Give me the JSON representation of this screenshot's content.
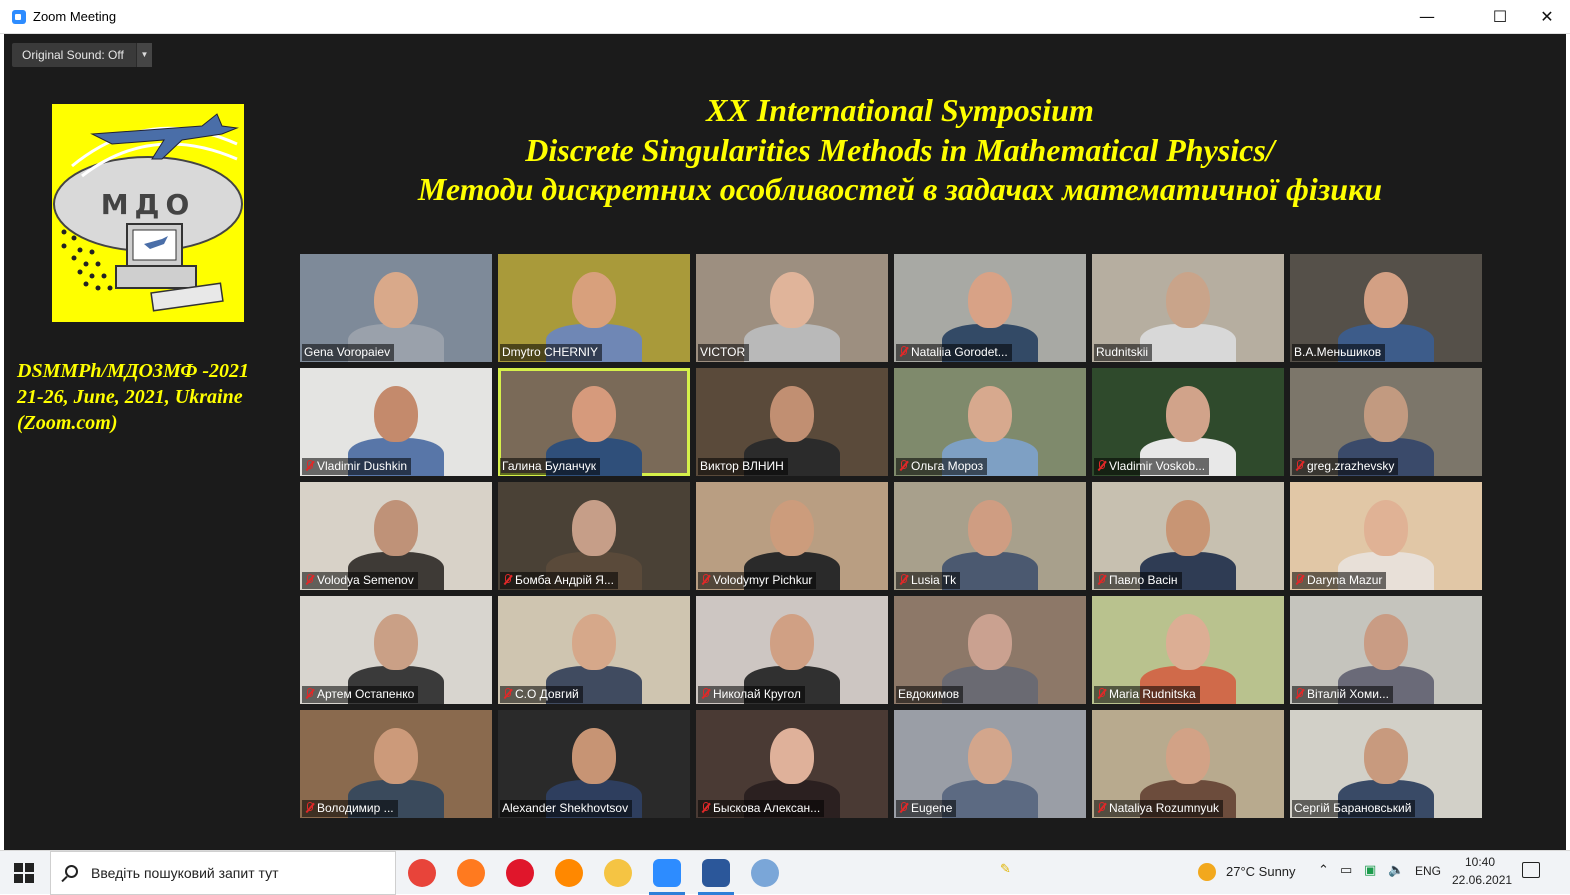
{
  "window": {
    "title": "Zoom Meeting",
    "minimize": "—",
    "maximize": "☐",
    "close": "✕"
  },
  "toolbar": {
    "original_sound": "Original Sound: Off",
    "dropdown_arrow": "▼"
  },
  "logo": {
    "text": "МДО"
  },
  "left_info": {
    "line1": "DSMMPh/МДОЗМФ -2021",
    "line2": "21-26, June, 2021, Ukraine",
    "line3": "(Zoom.com)"
  },
  "heading": {
    "line1": "XX International Symposium",
    "line2": "Discrete Singularities Methods in Mathematical Physics/",
    "line3": "Методи дискретних особливостей в задачах математичної фізики"
  },
  "participants": [
    {
      "name": "Gena Voropaiev",
      "muted": false,
      "bg": "#7e8a99",
      "skin": "#d9a98a",
      "shirt": "#9aa1ab"
    },
    {
      "name": "Dmytro CHERNIY",
      "muted": false,
      "bg": "#a99a3a",
      "skin": "#d8a07c",
      "shirt": "#6f87b5"
    },
    {
      "name": "VICTOR",
      "muted": false,
      "bg": "#9d8f80",
      "skin": "#e0b49a",
      "shirt": "#b9b9b9"
    },
    {
      "name": "Nataliia Gorodet...",
      "muted": true,
      "bg": "#a8a9a4",
      "skin": "#d8a286",
      "shirt": "#334a66"
    },
    {
      "name": "Rudnitskii",
      "muted": false,
      "bg": "#b6aea0",
      "skin": "#c9a48a",
      "shirt": "#d8d8d8"
    },
    {
      "name": "В.А.Меньшиков",
      "muted": false,
      "bg": "#555049",
      "skin": "#d3a084",
      "shirt": "#3d5c8a"
    },
    {
      "name": "Vladimir Dushkin",
      "muted": true,
      "bg": "#e4e4e2",
      "skin": "#c48a6c",
      "shirt": "#5876a8"
    },
    {
      "name": "Галина Буланчук",
      "muted": false,
      "bg": "#7a6a58",
      "skin": "#d69a7c",
      "shirt": "#2f4f7a"
    },
    {
      "name": "Виктор ВЛНИН",
      "muted": false,
      "bg": "#5a4a3a",
      "skin": "#c18f72",
      "shirt": "#2b2b2b"
    },
    {
      "name": "Ольга Мороз",
      "muted": true,
      "bg": "#7f8a6c",
      "skin": "#d7a98e",
      "shirt": "#7ea0c4"
    },
    {
      "name": "Vladimir Voskob...",
      "muted": true,
      "bg": "#2f4a2c",
      "skin": "#d1a38a",
      "shirt": "#e8e8e8"
    },
    {
      "name": "greg.zrazhevsky",
      "muted": true,
      "bg": "#7c766a",
      "skin": "#c29a80",
      "shirt": "#3a4a6a"
    },
    {
      "name": "Volodya Semenov",
      "muted": true,
      "bg": "#d8d2c8",
      "skin": "#bf9278",
      "shirt": "#3e3a36"
    },
    {
      "name": "Бомба Андрій Я...",
      "muted": true,
      "bg": "#4a4136",
      "skin": "#c69e88",
      "shirt": "#5a4a3a"
    },
    {
      "name": "Volodymyr Pichkur",
      "muted": true,
      "bg": "#b99e82",
      "skin": "#cc9c7c",
      "shirt": "#2a2a2a"
    },
    {
      "name": "Lusia Tk",
      "muted": true,
      "bg": "#a8a08c",
      "skin": "#cf9d82",
      "shirt": "#4b5970"
    },
    {
      "name": "Павло Васін",
      "muted": true,
      "bg": "#c7c0b0",
      "skin": "#c89574",
      "shirt": "#2f3c54"
    },
    {
      "name": "Daryna Mazur",
      "muted": true,
      "bg": "#e1c7a6",
      "skin": "#e0b295",
      "shirt": "#e8e0d8"
    },
    {
      "name": "Артем Остапенко",
      "muted": true,
      "bg": "#d8d5cf",
      "skin": "#caa086",
      "shirt": "#3a3a3a"
    },
    {
      "name": "С.О Довгий",
      "muted": true,
      "bg": "#cfc5b0",
      "skin": "#d6a88a",
      "shirt": "#404b60"
    },
    {
      "name": "Николай Кругол",
      "muted": true,
      "bg": "#cdc6c2",
      "skin": "#d0a084",
      "shirt": "#303030"
    },
    {
      "name": "Евдокимов",
      "muted": false,
      "bg": "#8d7868",
      "skin": "#caa190",
      "shirt": "#6a6a72"
    },
    {
      "name": "Maria Rudnitska",
      "muted": true,
      "bg": "#b9c28e",
      "skin": "#dcae94",
      "shirt": "#d06a4a"
    },
    {
      "name": "Віталій Хоми...",
      "muted": true,
      "bg": "#c5c4bd",
      "skin": "#c99c84",
      "shirt": "#6a6a78"
    },
    {
      "name": "Володимир ...",
      "muted": true,
      "bg": "#8a6a4e",
      "skin": "#cc9a7a",
      "shirt": "#3a4a5c"
    },
    {
      "name": "Alexander Shekhovtsov",
      "muted": false,
      "bg": "#2a2a2a",
      "skin": "#c79474",
      "shirt": "#2e3e5e"
    },
    {
      "name": "Быскова Алексан...",
      "muted": true,
      "bg": "#4a3a34",
      "skin": "#dfb19a",
      "shirt": "#2b2020"
    },
    {
      "name": "Eugene",
      "muted": true,
      "bg": "#9a9ea6",
      "skin": "#d3a68c",
      "shirt": "#5c6a82"
    },
    {
      "name": "Nataliya Rozumnyuk",
      "muted": true,
      "bg": "#b8aa8e",
      "skin": "#d2a286",
      "shirt": "#6c4c3c"
    },
    {
      "name": "Сергій Барановський",
      "muted": false,
      "bg": "#d2d0c8",
      "skin": "#c89a7e",
      "shirt": "#394a66"
    }
  ],
  "taskbar": {
    "search_placeholder": "Введіть пошуковий запит тут",
    "apps": [
      {
        "icon": "chrome-icon",
        "color": "#e8443a"
      },
      {
        "icon": "firefox-icon",
        "color": "#ff7a1f"
      },
      {
        "icon": "opera-icon",
        "color": "#e0162b"
      },
      {
        "icon": "vlc-icon",
        "color": "#ff8800"
      },
      {
        "icon": "file-explorer-icon",
        "color": "#f5c443"
      },
      {
        "icon": "zoom-icon",
        "color": "#2d8cff"
      },
      {
        "icon": "word-icon",
        "color": "#2b579a"
      },
      {
        "icon": "paint-icon",
        "color": "#7aa6d8"
      }
    ],
    "weather_temp": "27°C",
    "weather_desc": "Sunny",
    "language": "ENG",
    "time": "10:40",
    "date": "22.06.2021"
  }
}
